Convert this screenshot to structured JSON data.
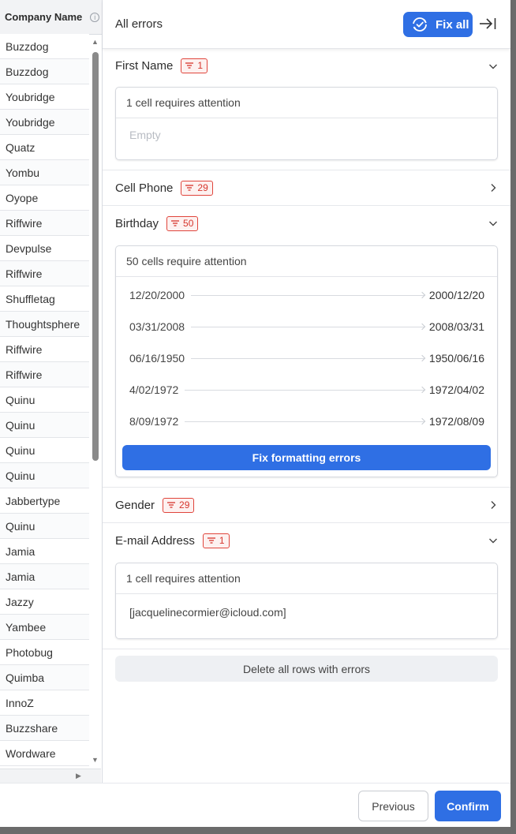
{
  "grid": {
    "header": "Company Name",
    "info_icon": "info-icon",
    "rows": [
      "Buzzdog",
      "Buzzdog",
      "Youbridge",
      "Youbridge",
      "Quatz",
      "Yombu",
      "Oyope",
      "Riffwire",
      "Devpulse",
      "Riffwire",
      "Shuffletag",
      "Thoughtsphere",
      "Riffwire",
      "Riffwire",
      "Quinu",
      "Quinu",
      "Quinu",
      "Quinu",
      "Jabbertype",
      "Quinu",
      "Jamia",
      "Jamia",
      "Jazzy",
      "Yambee",
      "Photobug",
      "Quimba",
      "InnoZ",
      "Buzzshare",
      "Wordware"
    ]
  },
  "panel": {
    "title": "All errors",
    "fix_all_label": "Fix all",
    "sections": {
      "first_name": {
        "name": "First Name",
        "count": "1",
        "attention": "1 cell requires attention",
        "value": "Empty"
      },
      "cell_phone": {
        "name": "Cell Phone",
        "count": "29"
      },
      "birthday": {
        "name": "Birthday",
        "count": "50",
        "attention": "50 cells require attention",
        "fixes": [
          {
            "from": "12/20/2000",
            "to": "2000/12/20"
          },
          {
            "from": "03/31/2008",
            "to": "2008/03/31"
          },
          {
            "from": "06/16/1950",
            "to": "1950/06/16"
          },
          {
            "from": "4/02/1972",
            "to": "1972/04/02"
          },
          {
            "from": "8/09/1972",
            "to": "1972/08/09"
          }
        ],
        "fix_button": "Fix formatting errors"
      },
      "gender": {
        "name": "Gender",
        "count": "29"
      },
      "email": {
        "name": "E-mail Address",
        "count": "1",
        "attention": "1 cell requires attention",
        "value": "[jacquelinecormier@icloud.com]"
      }
    },
    "delete_rows_label": "Delete all rows with errors"
  },
  "footer": {
    "previous_label": "Previous",
    "confirm_label": "Confirm"
  },
  "colors": {
    "accent": "#2f6fe4",
    "error": "#d6352c"
  }
}
